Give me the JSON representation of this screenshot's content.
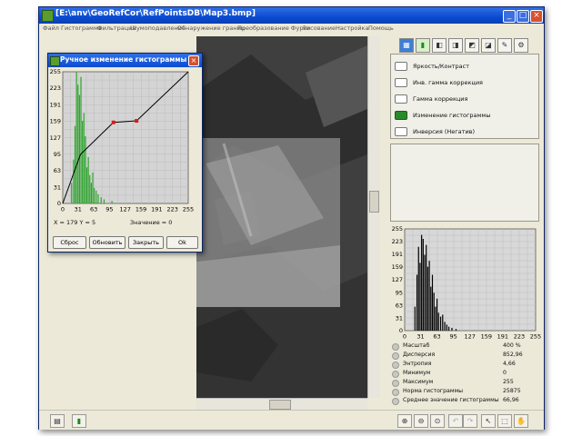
{
  "window": {
    "title": "[E:\\anv\\GeoRefCor\\RefPointsDB\\Map3.bmp]",
    "buttons": {
      "minimize": "_",
      "maximize": "□",
      "close": "×"
    }
  },
  "menu": [
    "Файл",
    "Гистограмма",
    "Фильтрация",
    "Шумоподавление",
    "Обнаружение границ",
    "Преобразование Фурье",
    "Рисование",
    "Настройка",
    "Помощь"
  ],
  "dialog": {
    "title": "Ручное изменение гистограммы",
    "xy_readout": "X =  179    Y =  5",
    "value_readout": "Значение =  0",
    "buttons": {
      "reset": "Сброс",
      "update": "Обновить",
      "close": "Закрыть",
      "ok": "Ok"
    }
  },
  "operations": [
    {
      "label": "Яркость/Контраст",
      "icon": "brightness-icon"
    },
    {
      "label": "Инв. гамма коррекция",
      "icon": "inverse-gamma-icon"
    },
    {
      "label": "Гамма коррекция",
      "icon": "gamma-icon"
    },
    {
      "label": "Изменение гистограммы",
      "icon": "histogram-edit-icon"
    },
    {
      "label": "Инверсия (Негатив)",
      "icon": "invert-icon"
    }
  ],
  "stats": [
    {
      "label": "Масштаб",
      "value": "400 %"
    },
    {
      "label": "Дисперсия",
      "value": "852,96"
    },
    {
      "label": "Энтропия",
      "value": "4,66"
    },
    {
      "label": "Минимум",
      "value": "0"
    },
    {
      "label": "Максимум",
      "value": "255"
    },
    {
      "label": "Норма гистограммы",
      "value": "25875"
    },
    {
      "label": "Среднее значение гистограммы",
      "value": "66,96"
    }
  ],
  "chart_data": [
    {
      "type": "line",
      "title": "",
      "xlabel": "",
      "ylabel": "",
      "xticks": [
        "0",
        "31",
        "63",
        "95",
        "127",
        "159",
        "191",
        "223",
        "255"
      ],
      "yticks": [
        "0",
        "31",
        "63",
        "95",
        "127",
        "159",
        "191",
        "223",
        "255"
      ],
      "xlim": [
        0,
        255
      ],
      "ylim": [
        0,
        255
      ],
      "grid": true,
      "background_bar_color": "#2fa52f",
      "curve_color": "#000000",
      "control_point_color": "#e01818",
      "series": [
        {
          "x": [
            0,
            36,
            103,
            150,
            255
          ],
          "y": [
            0,
            95,
            157,
            160,
            255
          ]
        }
      ],
      "control_points": [
        {
          "x": 103,
          "y": 157
        },
        {
          "x": 150,
          "y": 160
        }
      ],
      "histogram_bars": [
        {
          "x": 18,
          "v": 40
        },
        {
          "x": 22,
          "v": 85
        },
        {
          "x": 25,
          "v": 150
        },
        {
          "x": 28,
          "v": 255
        },
        {
          "x": 31,
          "v": 230
        },
        {
          "x": 34,
          "v": 210
        },
        {
          "x": 37,
          "v": 245
        },
        {
          "x": 40,
          "v": 160
        },
        {
          "x": 43,
          "v": 175
        },
        {
          "x": 46,
          "v": 130
        },
        {
          "x": 49,
          "v": 70
        },
        {
          "x": 52,
          "v": 90
        },
        {
          "x": 55,
          "v": 55
        },
        {
          "x": 58,
          "v": 40
        },
        {
          "x": 61,
          "v": 60
        },
        {
          "x": 64,
          "v": 30
        },
        {
          "x": 68,
          "v": 25
        },
        {
          "x": 72,
          "v": 18
        },
        {
          "x": 78,
          "v": 12
        },
        {
          "x": 84,
          "v": 8
        },
        {
          "x": 100,
          "v": 5
        }
      ]
    },
    {
      "type": "bar",
      "title": "",
      "xlabel": "",
      "ylabel": "",
      "xticks": [
        "0",
        "31",
        "63",
        "95",
        "127",
        "159",
        "191",
        "223",
        "255"
      ],
      "yticks": [
        "0",
        "31",
        "63",
        "95",
        "127",
        "159",
        "191",
        "223",
        "255"
      ],
      "xlim": [
        0,
        255
      ],
      "ylim": [
        0,
        255
      ],
      "grid": true,
      "bar_color": "#000000",
      "histogram_bars": [
        {
          "x": 20,
          "v": 60
        },
        {
          "x": 24,
          "v": 140
        },
        {
          "x": 27,
          "v": 210
        },
        {
          "x": 30,
          "v": 170
        },
        {
          "x": 33,
          "v": 240
        },
        {
          "x": 36,
          "v": 230
        },
        {
          "x": 39,
          "v": 190
        },
        {
          "x": 42,
          "v": 215
        },
        {
          "x": 45,
          "v": 160
        },
        {
          "x": 48,
          "v": 175
        },
        {
          "x": 51,
          "v": 110
        },
        {
          "x": 54,
          "v": 140
        },
        {
          "x": 57,
          "v": 95
        },
        {
          "x": 60,
          "v": 60
        },
        {
          "x": 63,
          "v": 80
        },
        {
          "x": 66,
          "v": 45
        },
        {
          "x": 70,
          "v": 35
        },
        {
          "x": 74,
          "v": 40
        },
        {
          "x": 78,
          "v": 22
        },
        {
          "x": 82,
          "v": 15
        },
        {
          "x": 86,
          "v": 10
        },
        {
          "x": 92,
          "v": 7
        },
        {
          "x": 100,
          "v": 4
        }
      ]
    }
  ]
}
